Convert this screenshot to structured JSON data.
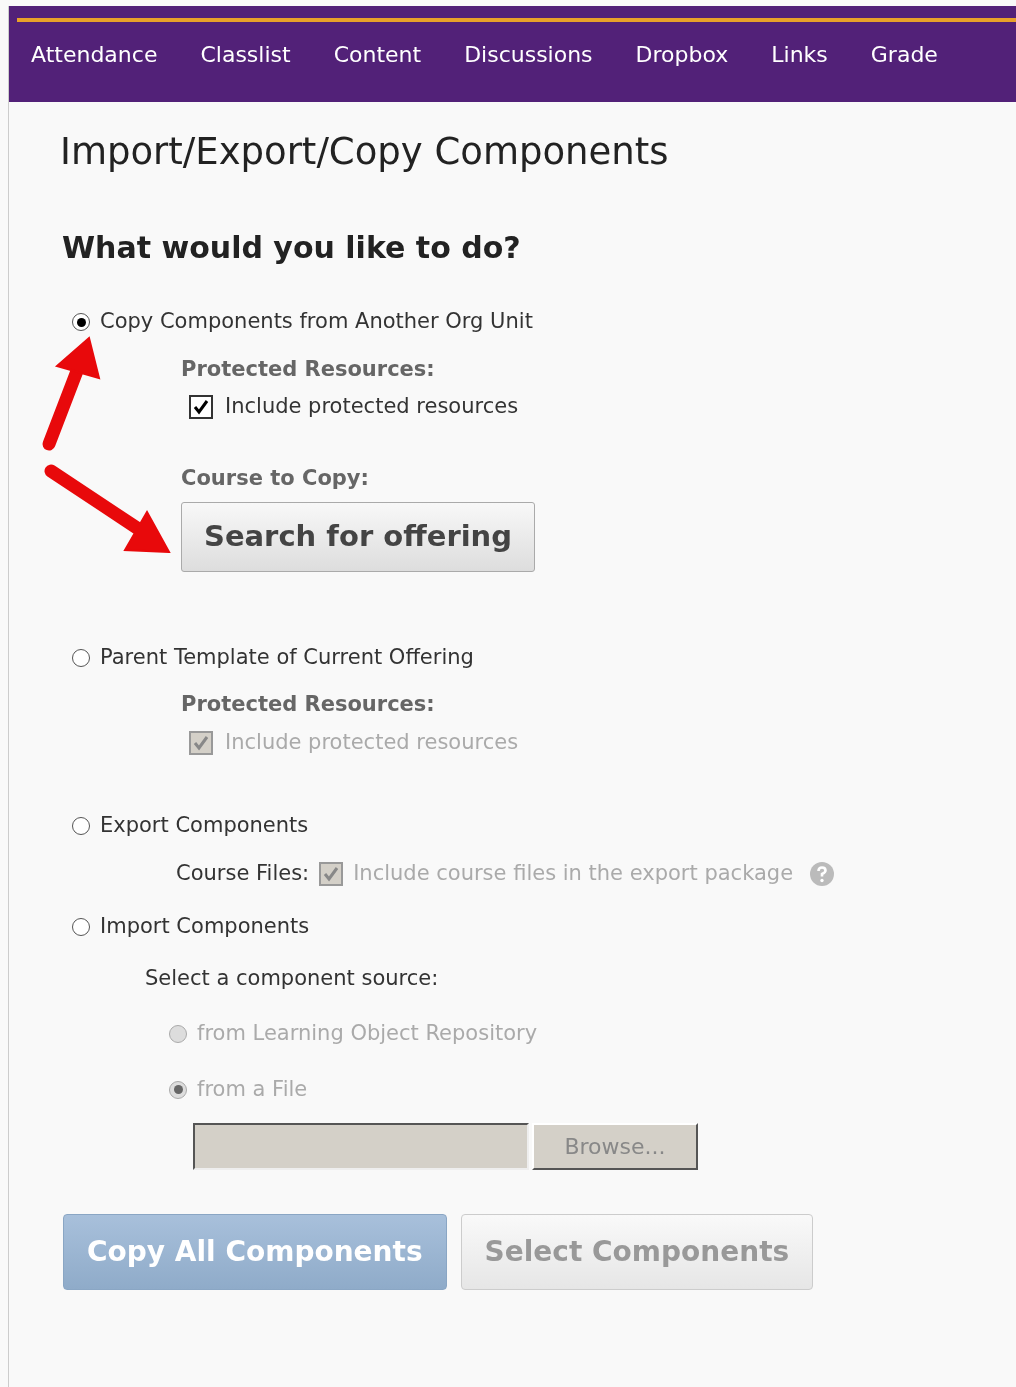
{
  "nav": {
    "items": [
      "Attendance",
      "Classlist",
      "Content",
      "Discussions",
      "Dropbox",
      "Links",
      "Grade"
    ]
  },
  "title": "Import/Export/Copy Components",
  "heading": "What would you like to do?",
  "options": [
    {
      "label": "Copy Components from Another Org Unit",
      "selected": true,
      "details": [
        {
          "kind": "subheading",
          "text": "Protected Resources:"
        },
        {
          "kind": "checkbox",
          "label": "Include protected resources",
          "checked": true,
          "disabled": false
        },
        {
          "kind": "subheading",
          "text": "Course to Copy:"
        },
        {
          "kind": "button",
          "label": "Search for offering"
        }
      ]
    },
    {
      "label": "Parent Template of Current Offering",
      "selected": false,
      "details": [
        {
          "kind": "subheading",
          "text": "Protected Resources:"
        },
        {
          "kind": "checkbox",
          "label": "Include protected resources",
          "checked": true,
          "disabled": true
        }
      ]
    },
    {
      "label": "Export Components",
      "selected": false,
      "details": [
        {
          "kind": "inline_checkbox",
          "prefix": "Course Files:",
          "label": "Include course files in the export package",
          "checked": true,
          "disabled": true,
          "help": true
        }
      ]
    },
    {
      "label": "Import Components",
      "selected": false,
      "details": [
        {
          "kind": "text",
          "text": "Select a component source:"
        },
        {
          "kind": "radio",
          "label": "from Learning Object Repository",
          "selected": false,
          "disabled": true
        },
        {
          "kind": "radio",
          "label": "from a File",
          "selected": true,
          "disabled": true
        },
        {
          "kind": "file",
          "button": "Browse...",
          "disabled": true
        }
      ]
    }
  ],
  "buttons": [
    {
      "label": "Copy All Components",
      "kind": "primary",
      "disabled": true
    },
    {
      "label": "Select Components",
      "kind": "secondary",
      "disabled": true
    }
  ]
}
